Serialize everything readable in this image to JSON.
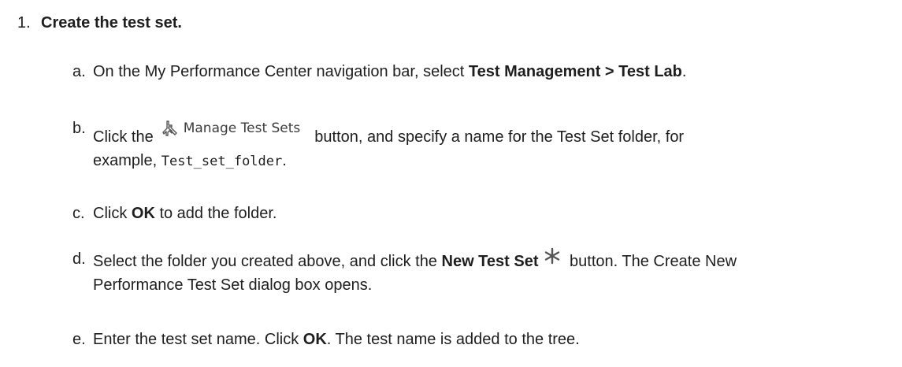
{
  "step": {
    "number": "1.",
    "title": "Create the test set."
  },
  "substeps": {
    "a": {
      "letter": "a.",
      "text1": "On the My Performance Center navigation bar, select ",
      "bold1": "Test Management > Test Lab",
      "text2": "."
    },
    "b": {
      "letter": "b.",
      "text1": "Click the",
      "button_label": "Manage Test Sets",
      "text2": "button, and specify a name for the Test Set folder, for",
      "text3": "example, ",
      "code": "Test_set_folder",
      "text4": "."
    },
    "c": {
      "letter": "c.",
      "text1": "Click ",
      "bold1": "OK",
      "text2": " to add the folder."
    },
    "d": {
      "letter": "d.",
      "text1": "Select the folder you created above, and click the ",
      "bold1": "New Test Set",
      "text2": " button. The Create New",
      "text3": "Performance Test Set dialog box opens."
    },
    "e": {
      "letter": "e.",
      "text1": "Enter the test set name. Click ",
      "bold1": "OK",
      "text2": ". The test name is added to the tree."
    }
  },
  "icons": {
    "manage_test_sets": "manage-test-sets-icon",
    "new_test_set": "asterisk-icon"
  }
}
